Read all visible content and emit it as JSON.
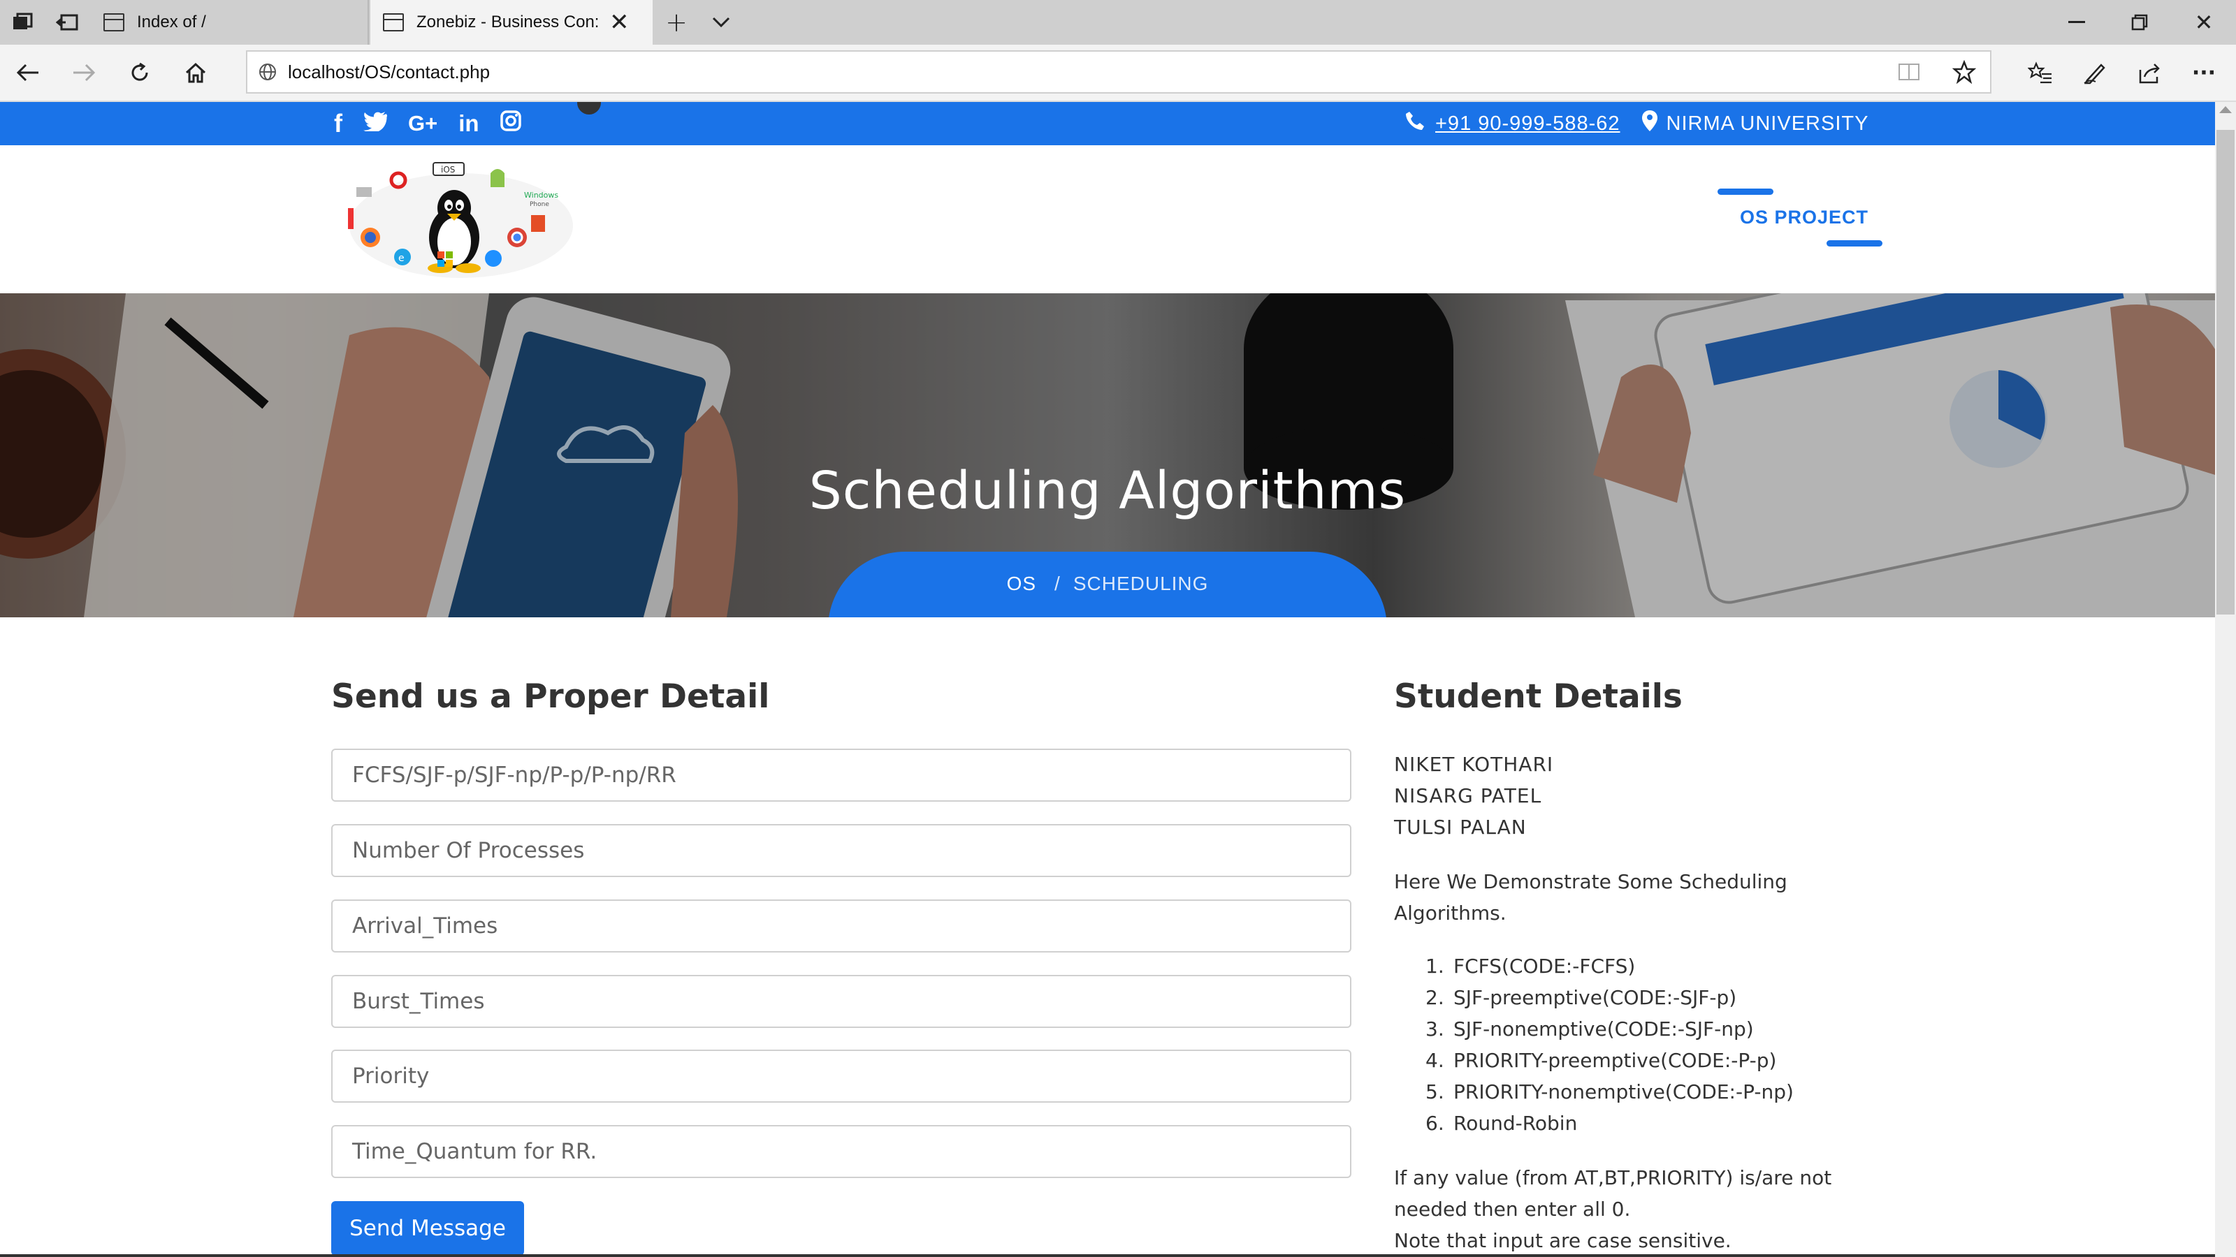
{
  "browser": {
    "tabs": [
      {
        "title": "Index of /",
        "active": false
      },
      {
        "title": "Zonebiz - Business Con:",
        "active": true
      }
    ],
    "url": "localhost/OS/contact.php"
  },
  "topbar": {
    "phone": "+91 90-999-588-62",
    "location": "NIRMA UNIVERSITY",
    "social_icons": [
      "facebook-icon",
      "twitter-icon",
      "google-plus-icon",
      "linkedin-icon",
      "instagram-icon"
    ]
  },
  "header": {
    "nav_item": "OS PROJECT"
  },
  "hero": {
    "title": "Scheduling Algorithms",
    "breadcrumb_home": "OS",
    "breadcrumb_sep": "/",
    "breadcrumb_current": "SCHEDULING"
  },
  "form": {
    "heading": "Send us a Proper Detail",
    "fields": [
      {
        "placeholder": "FCFS/SJF-p/SJF-np/P-p/P-np/RR"
      },
      {
        "placeholder": "Number Of Processes"
      },
      {
        "placeholder": "Arrival_Times"
      },
      {
        "placeholder": "Burst_Times"
      },
      {
        "placeholder": "Priority"
      },
      {
        "placeholder": "Time_Quantum for RR."
      }
    ],
    "submit_label": "Send Message"
  },
  "sidebar": {
    "heading": "Student Details",
    "students": [
      "NIKET KOTHARI",
      "NISARG PATEL",
      "TULSI PALAN"
    ],
    "intro": "Here We Demonstrate Some Scheduling Algorithms.",
    "algorithms": [
      "FCFS(CODE:-FCFS)",
      "SJF-preemptive(CODE:-SJF-p)",
      "SJF-nonemptive(CODE:-SJF-np)",
      "PRIORITY-preemptive(CODE:-P-p)",
      "PRIORITY-nonemptive(CODE:-P-np)",
      "Round-Robin"
    ],
    "note1": "If any value (from AT,BT,PRIORITY) is/are not needed then enter all 0.",
    "note2": "Note that input are case sensitive."
  },
  "colors": {
    "brand": "#1a73e8"
  }
}
